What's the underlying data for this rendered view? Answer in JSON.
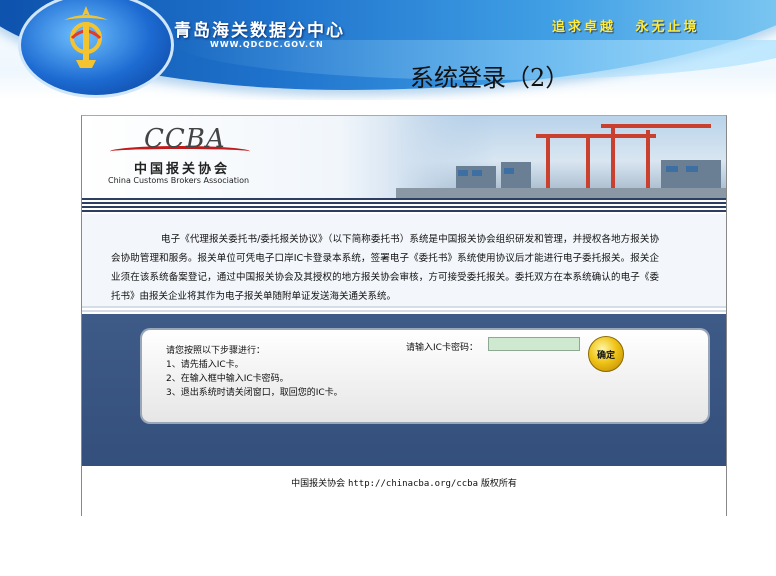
{
  "banner": {
    "site_name": "青岛海关数据分中心",
    "site_url": "WWW.QDCDC.GOV.CN",
    "slogan": "追求卓越  永无止境"
  },
  "page_title": "系统登录（2）",
  "hero": {
    "logo_text": "CCBA",
    "association_cn": "中国报关协会",
    "association_en": "China Customs Brokers Association"
  },
  "intro": {
    "text": "电子《代理报关委托书/委托报关协议》（以下简称委托书）系统是中国报关协会组织研发和管理，并授权各地方报关协会协助管理和服务。报关单位可凭电子口岸IC卡登录本系统，签署电子《委托书》系统使用协议后才能进行电子委托报关。报关企业须在该系统备案登记，通过中国报关协会及其授权的地方报关协会审核，方可接受委托报关。委托双方在本系统确认的电子《委托书》由报关企业将其作为电子报关单随附单证发送海关通关系统。"
  },
  "login": {
    "steps_title": "请您按照以下步骤进行：",
    "steps": [
      "1、请先插入IC卡。",
      "2、在输入框中输入IC卡密码。",
      "3、退出系统时请关闭窗口，取回您的IC卡。"
    ],
    "password_label": "请输入IC卡密码：",
    "password_value": "",
    "ok_label": "确定"
  },
  "footer": {
    "org": "中国报关协会",
    "url": "http://chinacba.org/ccba",
    "rights": "版权所有"
  },
  "colors": {
    "banner_blue": "#1f73cc",
    "slogan_yellow": "#ffeb3b",
    "login_band": "#3e5a86",
    "input_green": "#cfe8d0",
    "button_gold": "#f0c418"
  }
}
